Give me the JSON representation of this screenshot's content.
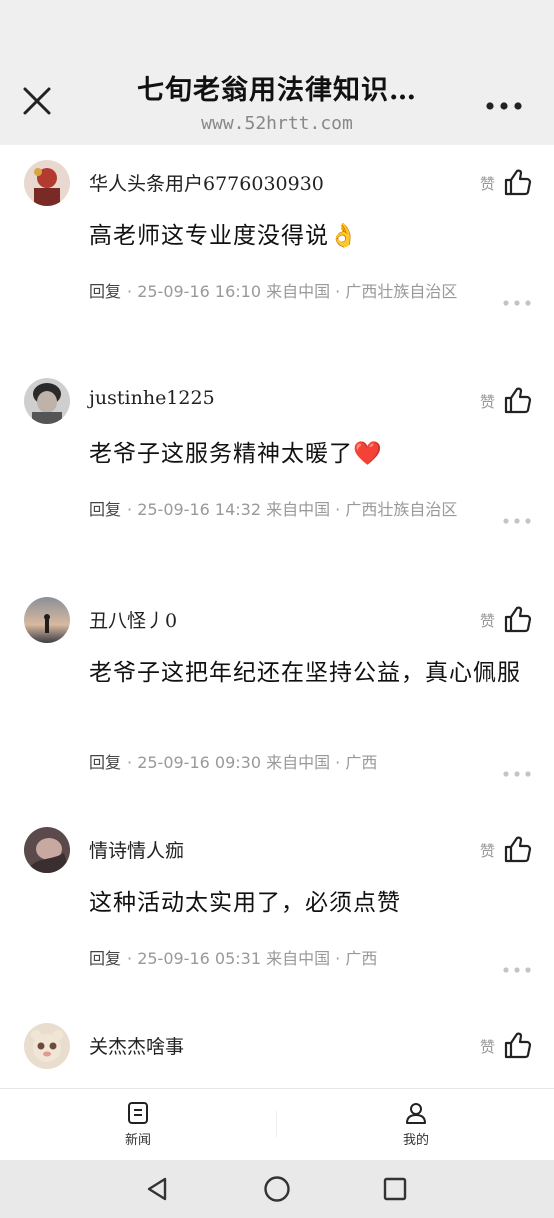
{
  "header": {
    "title": "七旬老翁用法律知识…",
    "subtitle": "www.52hrtt.com"
  },
  "comments": [
    {
      "username": "华人头条用户6776030930",
      "text": "高老师这专业度没得说👌",
      "like_label": "赞",
      "reply_label": "回复",
      "meta": "· 25-09-16  16:10  来自中国 · 广西壮族自治区"
    },
    {
      "username": "justinhe1225",
      "text": "老爷子这服务精神太暖了❤️",
      "like_label": "赞",
      "reply_label": "回复",
      "meta": "· 25-09-16  14:32  来自中国 · 广西壮族自治区"
    },
    {
      "username": "丑八怪丿0",
      "text": "老爷子这把年纪还在坚持公益，真心佩服",
      "like_label": "赞",
      "reply_label": "回复",
      "meta": "· 25-09-16  09:30  来自中国 · 广西"
    },
    {
      "username": "情诗情人痂",
      "text": "这种活动太实用了，必须点赞",
      "like_label": "赞",
      "reply_label": "回复",
      "meta": "· 25-09-16  05:31  来自中国 · 广西"
    },
    {
      "username": "关杰杰啥事",
      "like_label": "赞"
    }
  ],
  "tabs": [
    {
      "label": "新闻",
      "icon": "news-icon"
    },
    {
      "label": "我的",
      "icon": "profile-icon"
    }
  ],
  "colors": {
    "header_bg": "#efefef",
    "meta_text": "#999999",
    "nav_bg": "#e9e9e9"
  }
}
